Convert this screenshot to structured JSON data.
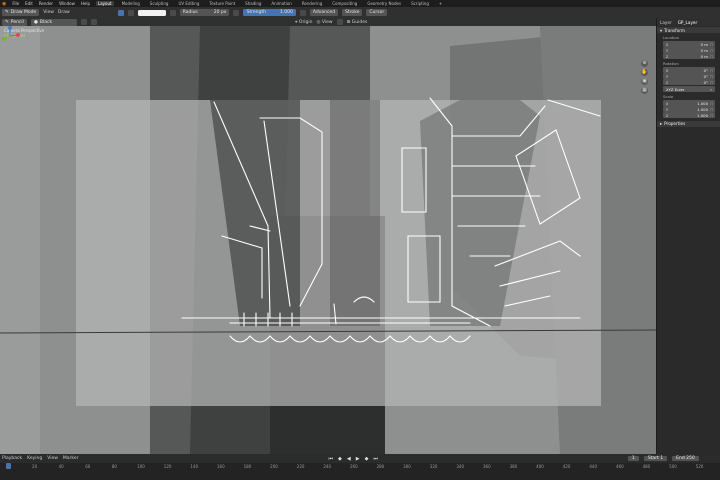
{
  "menubar": {
    "items": [
      "File",
      "Edit",
      "Render",
      "Window",
      "Help"
    ],
    "workspaces": [
      "Layout",
      "Modeling",
      "Sculpting",
      "UV Editing",
      "Texture Paint",
      "Shading",
      "Animation",
      "Rendering",
      "Compositing",
      "Geometry Nodes",
      "Scripting",
      "+"
    ],
    "active_workspace": "Layout"
  },
  "toolbar": {
    "mode": "Draw Mode",
    "menus": [
      "View",
      "Draw"
    ],
    "radius_label": "Radius",
    "radius_value": "20 px",
    "strength_label": "Strength",
    "strength_value": "1.000",
    "advanced": "Advanced",
    "stroke": "Stroke",
    "cursor": "Cursor"
  },
  "header2": {
    "brush": "Pencil",
    "material": "Black",
    "origin": "Origin",
    "view": "View",
    "guides": "Guides"
  },
  "viewport": {
    "overlay_mode": "Camera Perspective",
    "overlay_layer": "| GP_Layer"
  },
  "panel": {
    "tabs": [
      "Item",
      "Tool",
      "View",
      "Layer",
      "GP_Layer"
    ],
    "transform_title": "Transform",
    "location_label": "Location",
    "location": [
      {
        "axis": "X",
        "value": "0 m"
      },
      {
        "axis": "Y",
        "value": "0 m"
      },
      {
        "axis": "Z",
        "value": "0 m"
      }
    ],
    "rotation_label": "Rotation",
    "rotation": [
      {
        "axis": "X",
        "value": "0°"
      },
      {
        "axis": "Y",
        "value": "0°"
      },
      {
        "axis": "Z",
        "value": "0°"
      }
    ],
    "rotation_mode": "XYZ Euler",
    "scale_label": "Scale",
    "scale": [
      {
        "axis": "X",
        "value": "1.000"
      },
      {
        "axis": "Y",
        "value": "1.000"
      },
      {
        "axis": "Z",
        "value": "1.000"
      }
    ],
    "properties_title": "Properties"
  },
  "timeline": {
    "menus": [
      "Playback",
      "Keying",
      "View",
      "Marker"
    ],
    "current_frame": "1",
    "start_label": "Start",
    "start_value": "1",
    "end_label": "End",
    "end_value": "250",
    "ticks": [
      "1",
      "20",
      "40",
      "60",
      "80",
      "100",
      "120",
      "140",
      "160",
      "180",
      "200",
      "220",
      "240",
      "260",
      "280",
      "300",
      "320",
      "340",
      "360",
      "380",
      "400",
      "420",
      "440",
      "460",
      "480",
      "500",
      "520"
    ]
  },
  "colors": {
    "accent": "#4772b3",
    "layer_text": "#b7e06a",
    "viewport_bg": "#8d8f8e",
    "camera_frame": "#b5b7b6",
    "sketch_stroke": "#ffffff"
  }
}
